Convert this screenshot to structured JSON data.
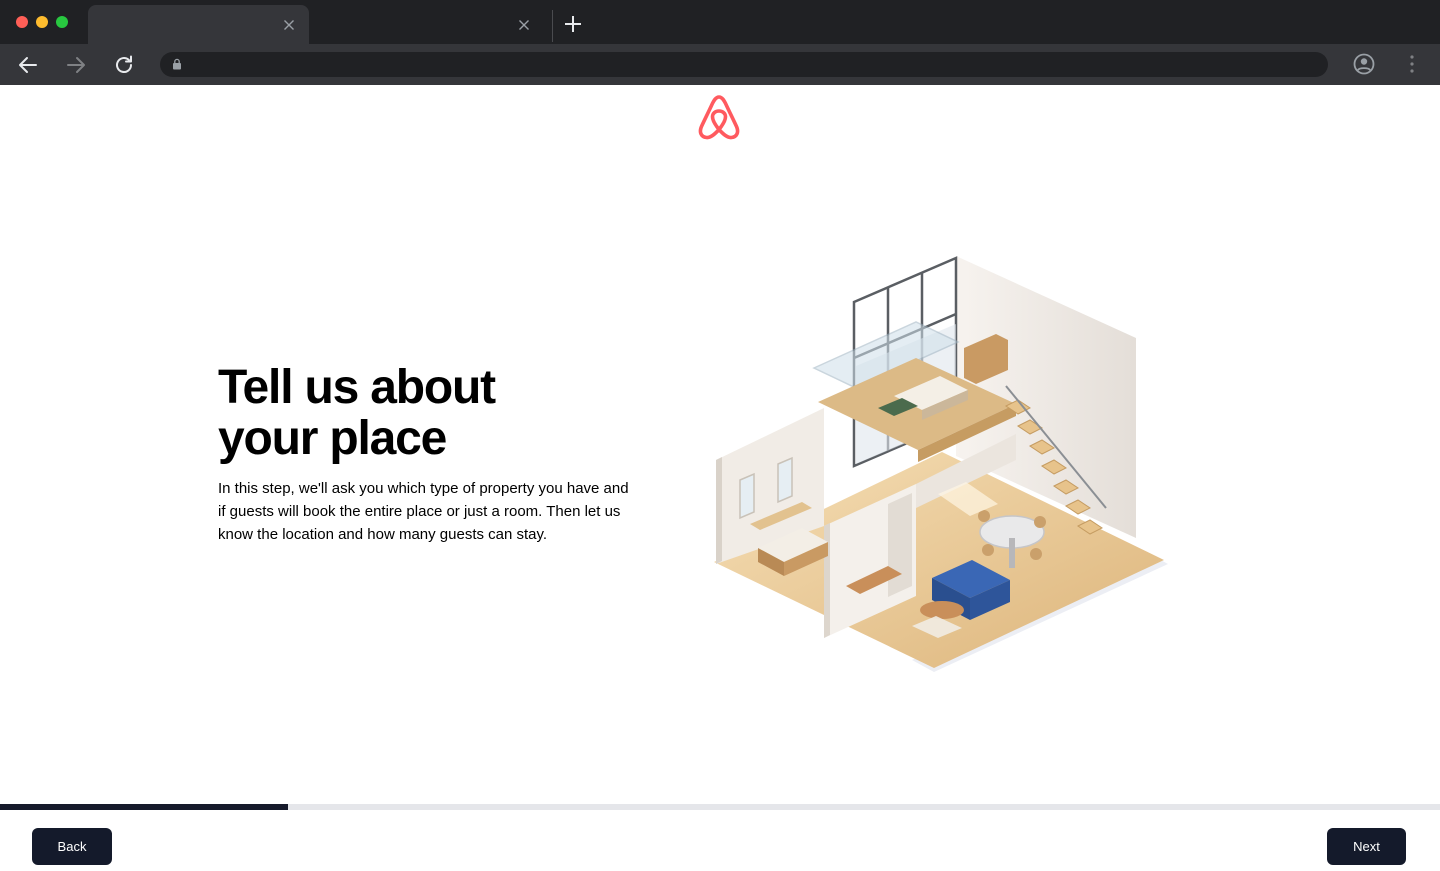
{
  "browser": {
    "tabs": [
      {
        "title": "",
        "active": true
      },
      {
        "title": "",
        "active": false
      }
    ],
    "address_bar": {
      "url": ""
    },
    "icons": {
      "tab_close": "close-icon",
      "new_tab": "plus-icon",
      "back": "arrow-left-icon",
      "forward": "arrow-right-icon",
      "reload": "reload-icon",
      "lock": "lock-icon",
      "profile": "account-circle-icon",
      "menu": "vertical-dots-icon"
    }
  },
  "page": {
    "logo": {
      "icon": "airbnb-logo-icon",
      "color": "#ff5a5f"
    },
    "heading": {
      "line1": "Tell us about",
      "line2": "your place"
    },
    "description": "In this step, we'll ask you which type of property you have and if guests will book the entire place or just a room. Then let us know the location and how many guests can stay.",
    "illustration": {
      "icon": "isometric-home-illustration"
    },
    "progress": {
      "value": 0.2
    },
    "footer": {
      "back_label": "Back",
      "next_label": "Next"
    },
    "colors": {
      "button_bg": "#141a2b",
      "progress_fill": "#161a2b",
      "progress_track": "#e5e6ea"
    }
  }
}
